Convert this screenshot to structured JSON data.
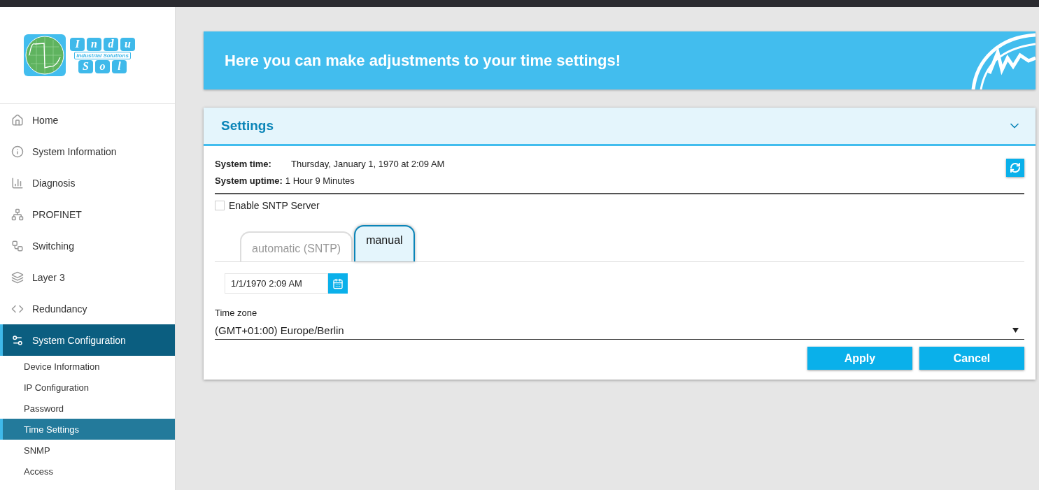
{
  "logo": {
    "top_letters": [
      "I",
      "n",
      "d",
      "u"
    ],
    "tagline": "Industrial Solutions",
    "bottom_letters": [
      "S",
      "o",
      "l"
    ]
  },
  "sidebar": {
    "items": [
      {
        "label": "Home",
        "selected": false
      },
      {
        "label": "System Information",
        "selected": false
      },
      {
        "label": "Diagnosis",
        "selected": false
      },
      {
        "label": "PROFINET",
        "selected": false
      },
      {
        "label": "Switching",
        "selected": false
      },
      {
        "label": "Layer 3",
        "selected": false
      },
      {
        "label": "Redundancy",
        "selected": false
      },
      {
        "label": "System Configuration",
        "selected": true,
        "children": [
          {
            "label": "Device Information",
            "selected": false
          },
          {
            "label": "IP Configuration",
            "selected": false
          },
          {
            "label": "Password",
            "selected": false
          },
          {
            "label": "Time Settings",
            "selected": true
          },
          {
            "label": "SNMP",
            "selected": false
          },
          {
            "label": "Access",
            "selected": false
          }
        ]
      }
    ]
  },
  "banner": {
    "title": "Here you can make adjustments to your time settings!"
  },
  "settings": {
    "title": "Settings",
    "expanded": true,
    "info": [
      {
        "label": "System time:",
        "value": "Thursday, January 1, 1970 at 2:09 AM"
      },
      {
        "label": "System uptime:",
        "value": "1 Hour 9 Minutes"
      }
    ],
    "sntp": {
      "label": "Enable SNTP Server",
      "checked": false
    },
    "tabs": [
      {
        "label": "automatic (SNTP)",
        "selected": false
      },
      {
        "label": "manual",
        "selected": true
      }
    ],
    "datetime": {
      "value": "1/1/1970 2:09 AM"
    },
    "timezone": {
      "label": "Time zone",
      "value": "(GMT+01:00) Europe/Berlin"
    },
    "buttons": [
      {
        "label": "Apply"
      },
      {
        "label": "Cancel"
      }
    ]
  }
}
